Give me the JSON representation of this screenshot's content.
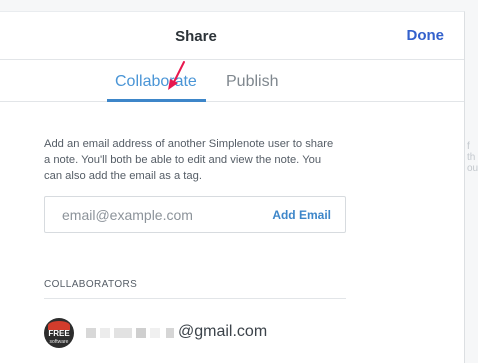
{
  "dialog": {
    "title": "Share",
    "done_label": "Done"
  },
  "tabs": [
    {
      "label": "Collaborate",
      "active": true
    },
    {
      "label": "Publish",
      "active": false
    }
  ],
  "collaborate": {
    "description": "Add an email address of another Simplenote user to share a note. You'll both be able to edit and view the note. You can also add the email as a tag.",
    "email_placeholder": "email@example.com",
    "add_email_label": "Add Email",
    "collaborators_heading": "COLLABORATORS",
    "collaborators": [
      {
        "email": "@gmail.com",
        "avatar_text": "FREE",
        "avatar_subtext": "software"
      }
    ]
  },
  "background_text": [
    "f th",
    "ou"
  ],
  "colors": {
    "accent": "#4a95d6",
    "done": "#3361cc",
    "arrow": "#e8174d"
  },
  "icons": {
    "annotation": "arrow-annotation-icon"
  }
}
